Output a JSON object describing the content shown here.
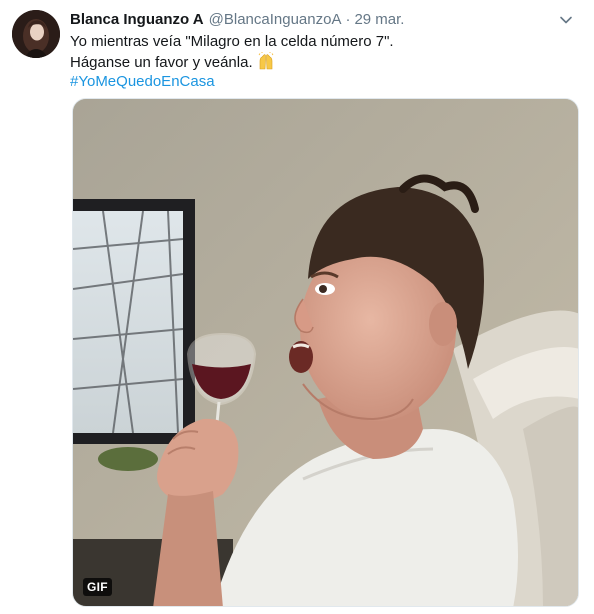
{
  "tweet": {
    "display_name": "Blanca Inguanzo A",
    "handle": "@BlancaInguanzoA",
    "separator": "·",
    "date": "29 mar.",
    "text_line1": "Yo mientras veía \"Milagro en la celda número 7\".",
    "text_line2": "Háganse un favor y veánla.",
    "hashtag": "#YoMeQuedoEnCasa",
    "media_badge": "GIF"
  },
  "icons": {
    "caret": "chevron-down-icon",
    "emoji": "raising-hands-emoji"
  },
  "colors": {
    "name": "#14171a",
    "secondary": "#657786",
    "link": "#1b95e0",
    "border": "#e1e8ed"
  }
}
